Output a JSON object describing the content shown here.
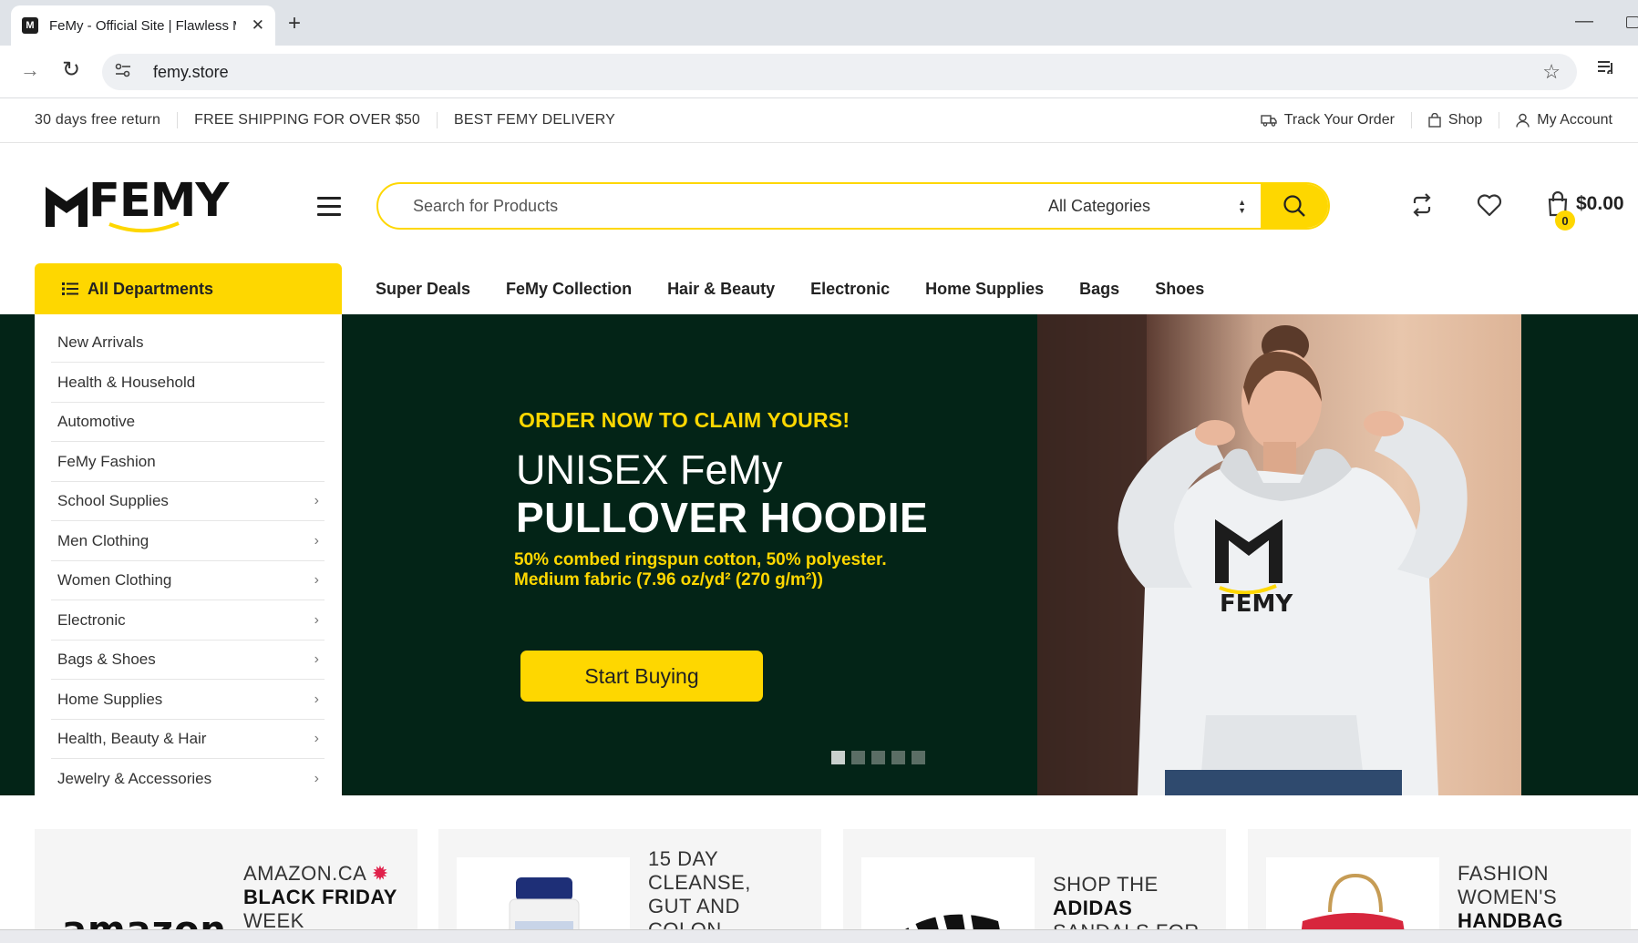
{
  "browser": {
    "tab_title": "FeMy - Official Site | Flawless M",
    "favicon_letter": "M",
    "url": "femy.store"
  },
  "topbar": {
    "left": [
      "30 days free return",
      "FREE SHIPPING FOR OVER $50",
      "BEST FEMY DELIVERY"
    ],
    "track": "Track Your Order",
    "shop": "Shop",
    "account": "My Account"
  },
  "header": {
    "logo_text": "FEMY",
    "search_placeholder": "Search for Products",
    "category": "All Categories",
    "cart_count": "0",
    "cart_total": "$0.00",
    "icons": [
      "compare-icon",
      "wishlist-heart-icon",
      "cart-bag-icon",
      "search-icon"
    ]
  },
  "nav": {
    "all_departments": "All Departments",
    "items": [
      "Super Deals",
      "FeMy Collection",
      "Hair & Beauty",
      "Electronic",
      "Home Supplies",
      "Bags",
      "Shoes"
    ]
  },
  "departments": [
    {
      "label": "New Arrivals",
      "sub": false
    },
    {
      "label": "Health & Household",
      "sub": false
    },
    {
      "label": "Automotive",
      "sub": false
    },
    {
      "label": "FeMy Fashion",
      "sub": false
    },
    {
      "label": "School Supplies",
      "sub": true
    },
    {
      "label": "Men Clothing",
      "sub": true
    },
    {
      "label": "Women Clothing",
      "sub": true
    },
    {
      "label": "Electronic",
      "sub": true
    },
    {
      "label": "Bags & Shoes",
      "sub": true
    },
    {
      "label": "Home Supplies",
      "sub": true
    },
    {
      "label": "Health, Beauty & Hair",
      "sub": true
    },
    {
      "label": "Jewelry & Accessories",
      "sub": true
    }
  ],
  "hero": {
    "kicker": "ORDER NOW TO CLAIM YOURS!",
    "line1": "UNISEX FeMy",
    "line2": "PULLOVER HOODIE",
    "desc1": "50% combed ringspun cotton, 50% polyester.",
    "desc2": "Medium fabric (7.96 oz/yd² (270 g/m²))",
    "button": "Start Buying",
    "hoodie_logo": "FEMY",
    "slides": 5,
    "active_slide": 1
  },
  "cards": [
    {
      "line1": "AMAZON.CA",
      "line2": "BLACK FRIDAY",
      "line3": "WEEK",
      "img_text": "amazon"
    },
    {
      "line1": "15 DAY",
      "line2": "CLEANSE,",
      "line3": "GUT AND",
      "line4": "COLON"
    },
    {
      "line1": "SHOP THE",
      "line2": "ADIDAS",
      "line3": "SANDALS FOR"
    },
    {
      "line1": "FASHION",
      "line2": "WOMEN'S",
      "line3": "HANDBAG"
    }
  ],
  "colors": {
    "accent": "#fed700",
    "hero_bg": "#032417"
  }
}
